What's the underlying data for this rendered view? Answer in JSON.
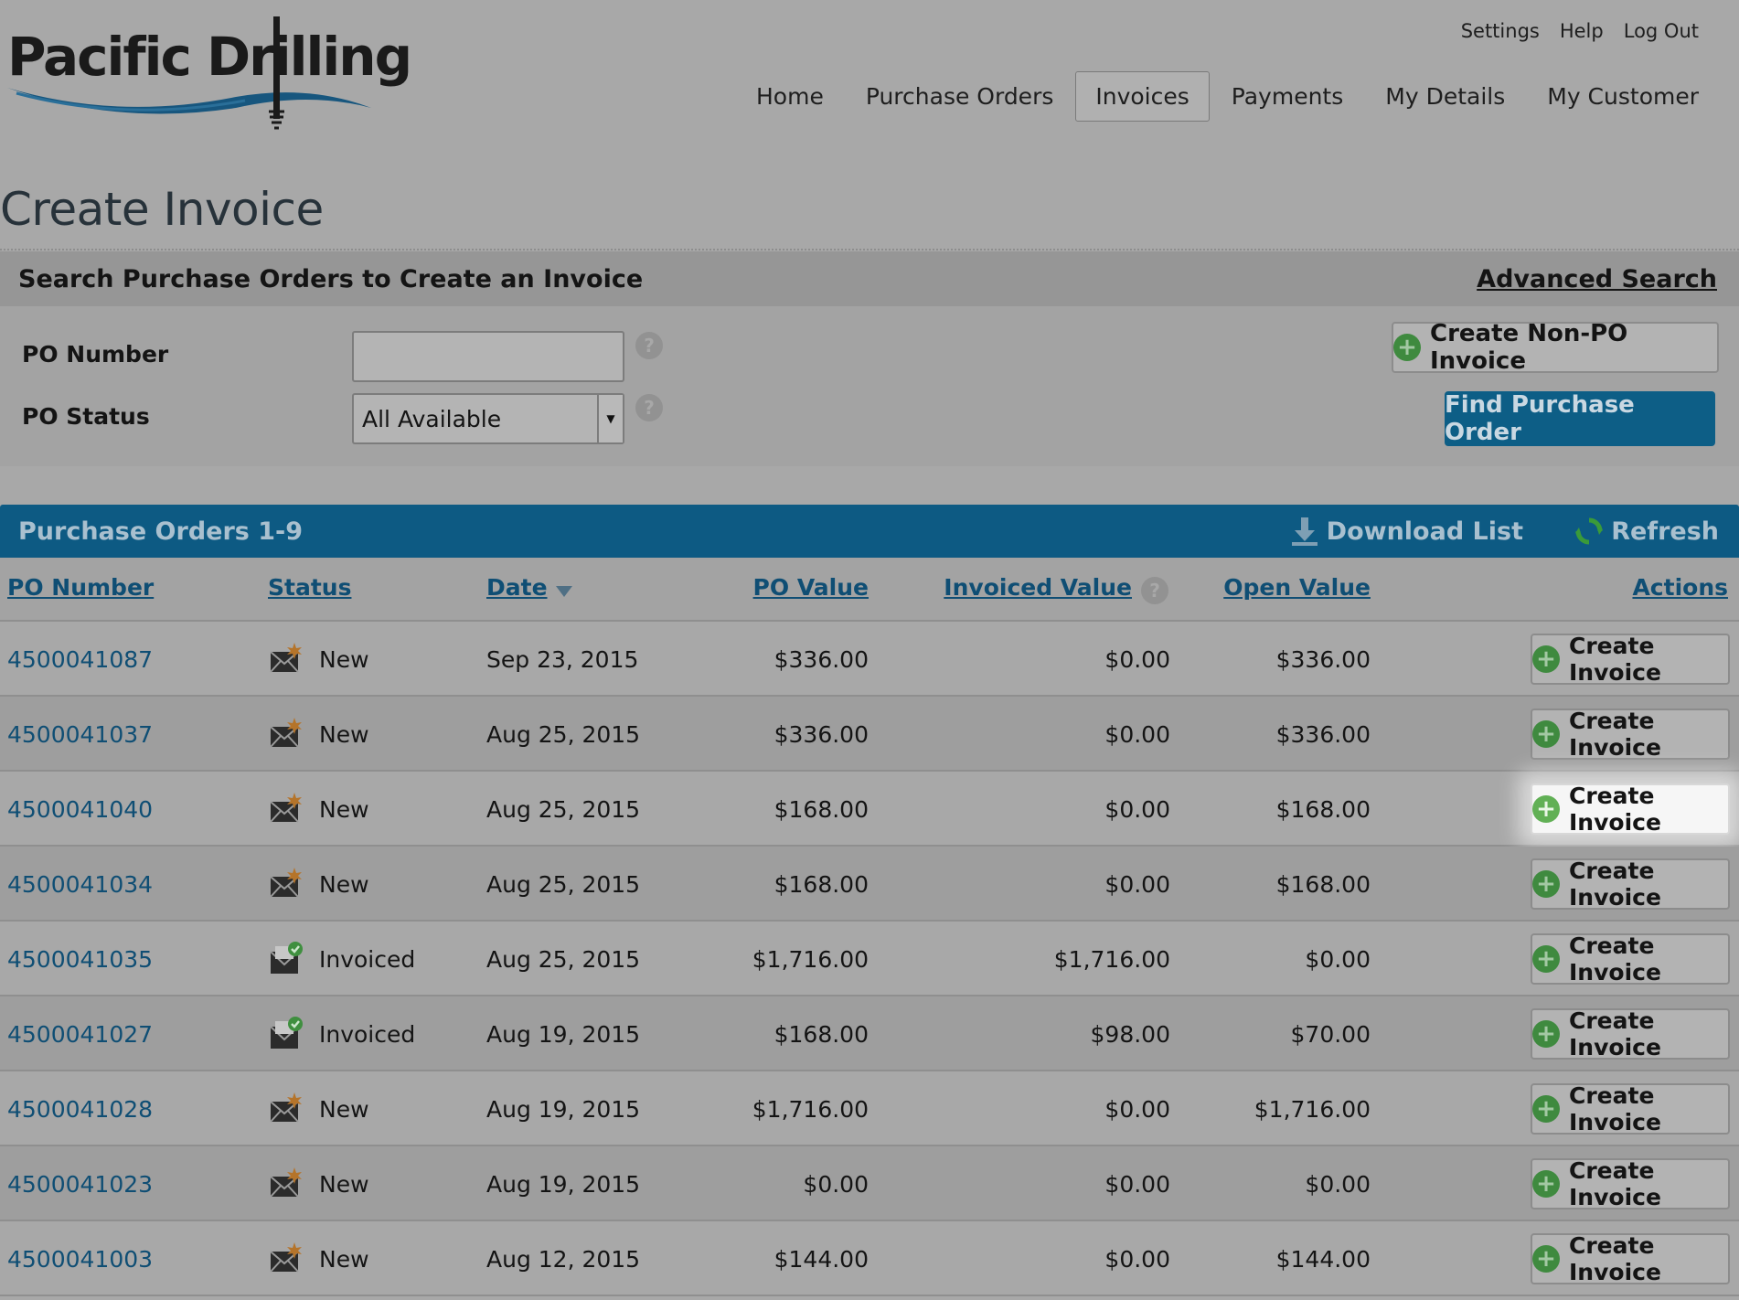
{
  "brand": {
    "name": "Pacific Drilling"
  },
  "header": {
    "utility_links": [
      "Settings",
      "Help",
      "Log Out"
    ],
    "nav": [
      {
        "label": "Home",
        "active": false
      },
      {
        "label": "Purchase Orders",
        "active": false
      },
      {
        "label": "Invoices",
        "active": true
      },
      {
        "label": "Payments",
        "active": false
      },
      {
        "label": "My Details",
        "active": false
      },
      {
        "label": "My Customer",
        "active": false
      }
    ]
  },
  "page": {
    "title": "Create Invoice"
  },
  "search": {
    "heading": "Search Purchase Orders to Create an Invoice",
    "advanced_link": "Advanced Search",
    "po_number_label": "PO Number",
    "po_number_value": "",
    "po_status_label": "PO Status",
    "po_status_value": "All Available",
    "help_glyph": "?",
    "create_non_po_label": "Create Non-PO Invoice",
    "find_label": "Find Purchase Order"
  },
  "results": {
    "title": "Purchase Orders 1-9",
    "download_label": "Download List",
    "refresh_label": "Refresh",
    "columns": {
      "po_number": "PO Number",
      "status": "Status",
      "date": "Date",
      "po_value": "PO Value",
      "invoiced_value": "Invoiced Value",
      "open_value": "Open Value",
      "actions": "Actions"
    },
    "action_label": "Create Invoice",
    "rows": [
      {
        "po": "4500041087",
        "status": "New",
        "date": "Sep 23, 2015",
        "po_value": "$336.00",
        "invoiced": "$0.00",
        "open": "$336.00"
      },
      {
        "po": "4500041037",
        "status": "New",
        "date": "Aug 25, 2015",
        "po_value": "$336.00",
        "invoiced": "$0.00",
        "open": "$336.00"
      },
      {
        "po": "4500041040",
        "status": "New",
        "date": "Aug 25, 2015",
        "po_value": "$168.00",
        "invoiced": "$0.00",
        "open": "$168.00"
      },
      {
        "po": "4500041034",
        "status": "New",
        "date": "Aug 25, 2015",
        "po_value": "$168.00",
        "invoiced": "$0.00",
        "open": "$168.00"
      },
      {
        "po": "4500041035",
        "status": "Invoiced",
        "date": "Aug 25, 2015",
        "po_value": "$1,716.00",
        "invoiced": "$1,716.00",
        "open": "$0.00"
      },
      {
        "po": "4500041027",
        "status": "Invoiced",
        "date": "Aug 19, 2015",
        "po_value": "$168.00",
        "invoiced": "$98.00",
        "open": "$70.00"
      },
      {
        "po": "4500041028",
        "status": "New",
        "date": "Aug 19, 2015",
        "po_value": "$1,716.00",
        "invoiced": "$0.00",
        "open": "$1,716.00"
      },
      {
        "po": "4500041023",
        "status": "New",
        "date": "Aug 19, 2015",
        "po_value": "$0.00",
        "invoiced": "$0.00",
        "open": "$0.00"
      },
      {
        "po": "4500041003",
        "status": "New",
        "date": "Aug 12, 2015",
        "po_value": "$144.00",
        "invoiced": "$0.00",
        "open": "$144.00"
      }
    ],
    "highlighted_row_index": 2
  },
  "colors": {
    "brand_blue": "#0d5a83",
    "link_blue": "#0f4e74",
    "add_green": "#3f8a3f"
  },
  "icons": {
    "status_new": "envelope-new-icon",
    "status_invoiced": "envelope-invoiced-icon",
    "download": "download-icon",
    "refresh": "refresh-icon",
    "add": "plus-circle-icon",
    "help": "help-icon",
    "sort": "sort-desc-icon"
  }
}
